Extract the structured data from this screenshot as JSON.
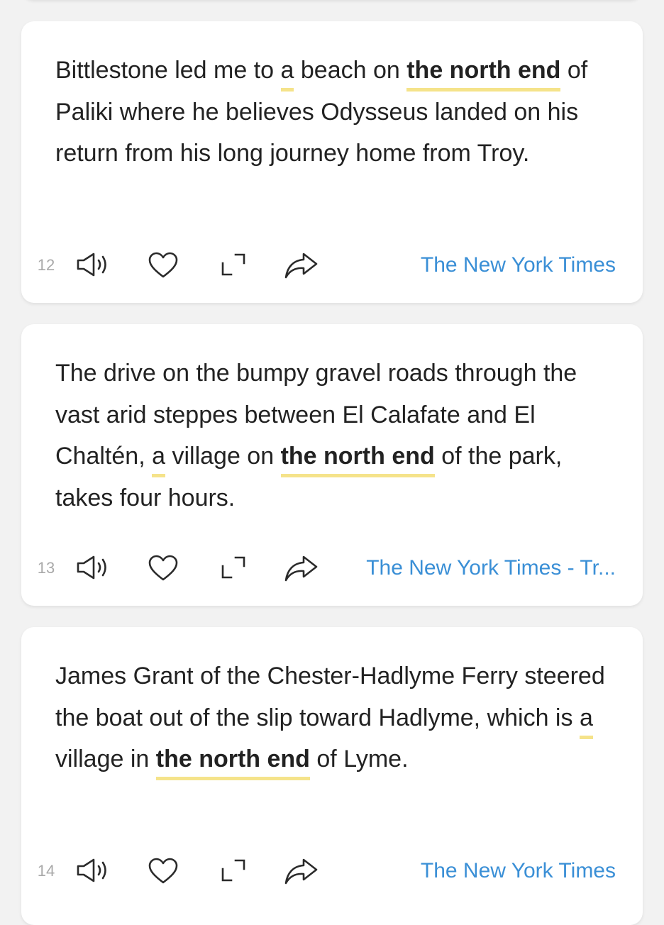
{
  "colors": {
    "background": "#f2f2f2",
    "card": "#ffffff",
    "text": "#222222",
    "highlight": "#f5e38a",
    "link": "#3a8fd6",
    "number": "#a9a9a9"
  },
  "icons": [
    "speaker-icon",
    "heart-icon",
    "expand-icon",
    "share-icon"
  ],
  "cards": [
    {
      "number": "12",
      "s1": "Bittlestone led me to ",
      "a": "a",
      "s2": " beach on ",
      "phrase": "the north end",
      "s3": " of Paliki where he believes Odysseus landed on his return from his long journey home from Troy.",
      "source": "The New York Times"
    },
    {
      "number": "13",
      "s1": "The drive on the bumpy gravel roads through the vast arid steppes between El Calafate and El Chaltén, ",
      "a": "a",
      "s2": " village on ",
      "phrase": "the north end",
      "s3": " of the park, takes four hours.",
      "source": "The New York Times - Tr..."
    },
    {
      "number": "14",
      "s1": "James Grant of the Chester-Hadlyme Ferry steered the boat out of the slip toward Hadlyme, which is ",
      "a": "a",
      "s2": " village in ",
      "phrase": "the north end",
      "s3": " of Lyme.",
      "source": "The New York Times"
    }
  ]
}
